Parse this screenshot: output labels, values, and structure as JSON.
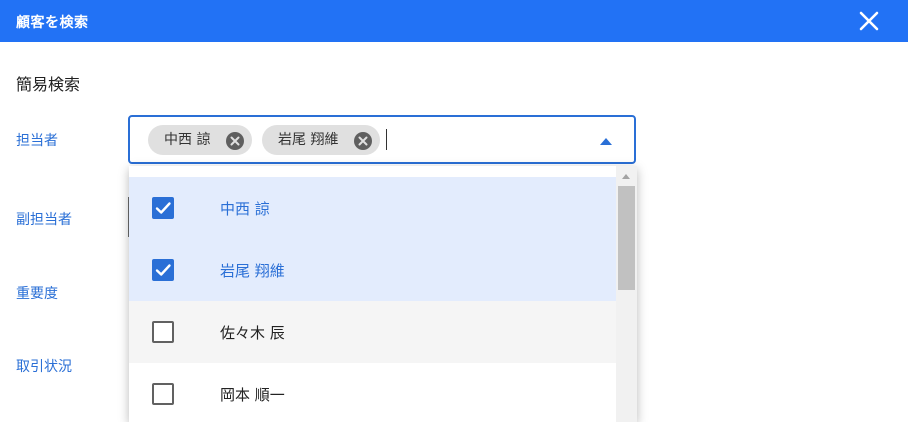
{
  "dialog": {
    "title": "顧客を検索"
  },
  "section": {
    "title": "簡易検索"
  },
  "labels": {
    "assignee": "担当者",
    "sub_assignee": "副担当者",
    "importance": "重要度",
    "deal_status": "取引状況"
  },
  "selected_chips": [
    {
      "label": "中西 諒"
    },
    {
      "label": "岩尾 翔維"
    }
  ],
  "options": [
    {
      "label": "中西 諒",
      "checked": true
    },
    {
      "label": "岩尾 翔維",
      "checked": true
    },
    {
      "label": "佐々木 辰",
      "checked": false
    },
    {
      "label": "岡本 順一",
      "checked": false
    }
  ],
  "colors": {
    "header": "#2272f5",
    "accent": "#2a6fd6",
    "selected_row": "#e3ecfd"
  }
}
